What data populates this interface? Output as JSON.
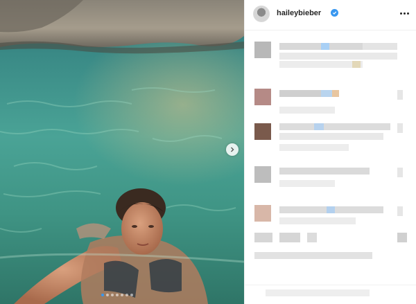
{
  "post": {
    "username": "haileybieber",
    "verified": true,
    "more_icon": "more-horizontal-icon",
    "carousel": {
      "slide_count": 7,
      "active_index": 0,
      "next_icon": "chevron-right-icon"
    }
  },
  "colors": {
    "verified_blue": "#3897f0",
    "water_light": "#5fb59b",
    "water_dark": "#2e6f73",
    "rock": "#9a9183"
  }
}
